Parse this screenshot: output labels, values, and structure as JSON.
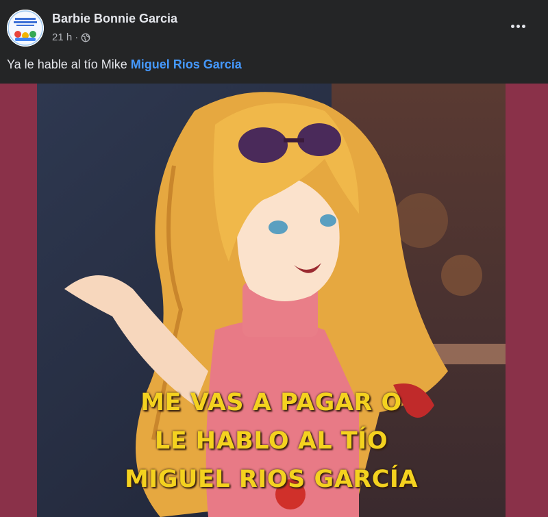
{
  "post": {
    "author": "Barbie Bonnie Garcia",
    "time": "21 h",
    "separator": "·",
    "audience_icon": "globe-icon",
    "more_icon": "more-options-icon",
    "caption_text": "Ya le hable al tío Mike ",
    "caption_mention": "Miguel Rios García"
  },
  "meme": {
    "lines": [
      "ME VAS A PAGAR O",
      "LE HABLO AL TÍO",
      "MIGUEL RIOS GARCÍA"
    ]
  },
  "colors": {
    "background": "#242526",
    "text": "#e4e6eb",
    "secondary": "#b0b3b8",
    "mention": "#4599ff",
    "media_border": "#8a3149",
    "meme_text": "#f4d21f"
  }
}
